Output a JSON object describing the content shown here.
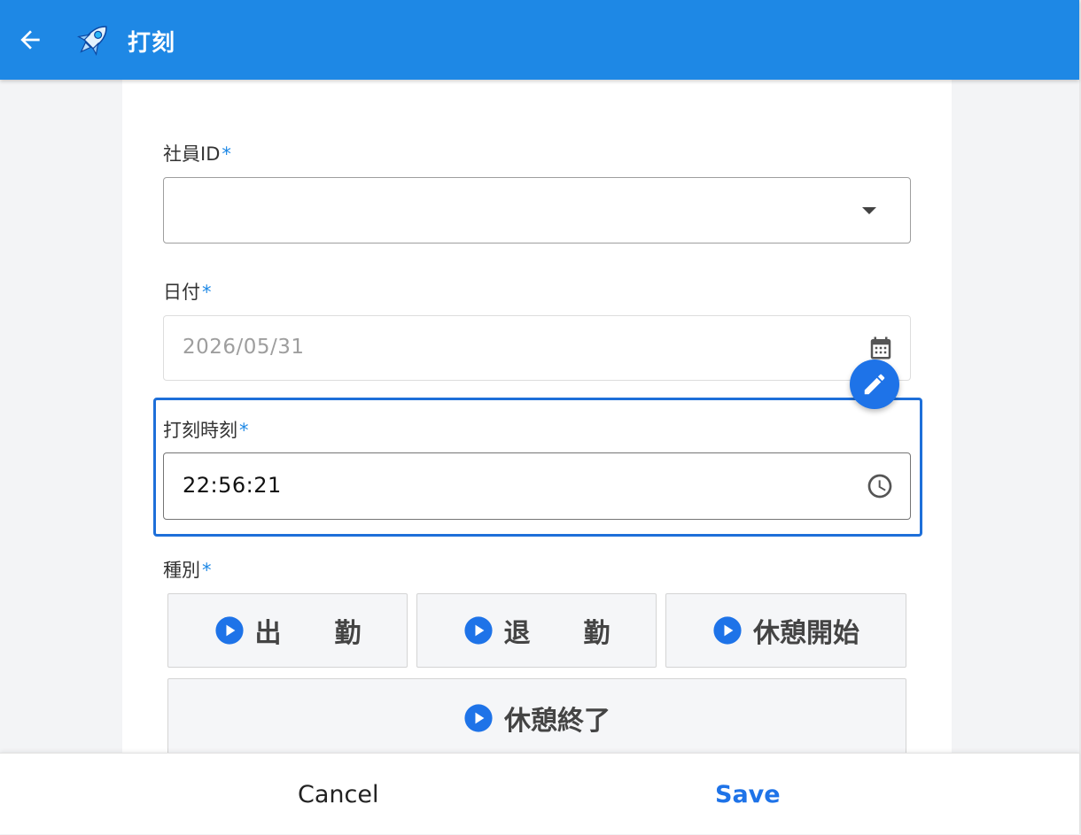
{
  "appbar": {
    "title": "打刻",
    "back_icon": "arrow-left-icon",
    "logo_icon": "rocket-icon",
    "color": "#1e88e5"
  },
  "form": {
    "employee_id": {
      "label": "社員ID",
      "required_mark": "*",
      "value": ""
    },
    "date": {
      "label": "日付",
      "required_mark": "*",
      "value": "2026/05/31",
      "icon": "calendar-icon"
    },
    "time": {
      "label": "打刻時刻",
      "required_mark": "*",
      "value": "22:56:21",
      "icon": "clock-icon"
    },
    "type": {
      "label": "種別",
      "required_mark": "*",
      "options": [
        {
          "label": "出　　勤",
          "icon": "play-circle-icon"
        },
        {
          "label": "退　　勤",
          "icon": "play-circle-icon"
        },
        {
          "label": "休憩開始",
          "icon": "play-circle-icon"
        },
        {
          "label": "休憩終了",
          "icon": "play-circle-icon"
        }
      ]
    },
    "edit_icon": "pencil-icon"
  },
  "actions": {
    "cancel_label": "Cancel",
    "save_label": "Save",
    "accent": "#1e73e8"
  }
}
